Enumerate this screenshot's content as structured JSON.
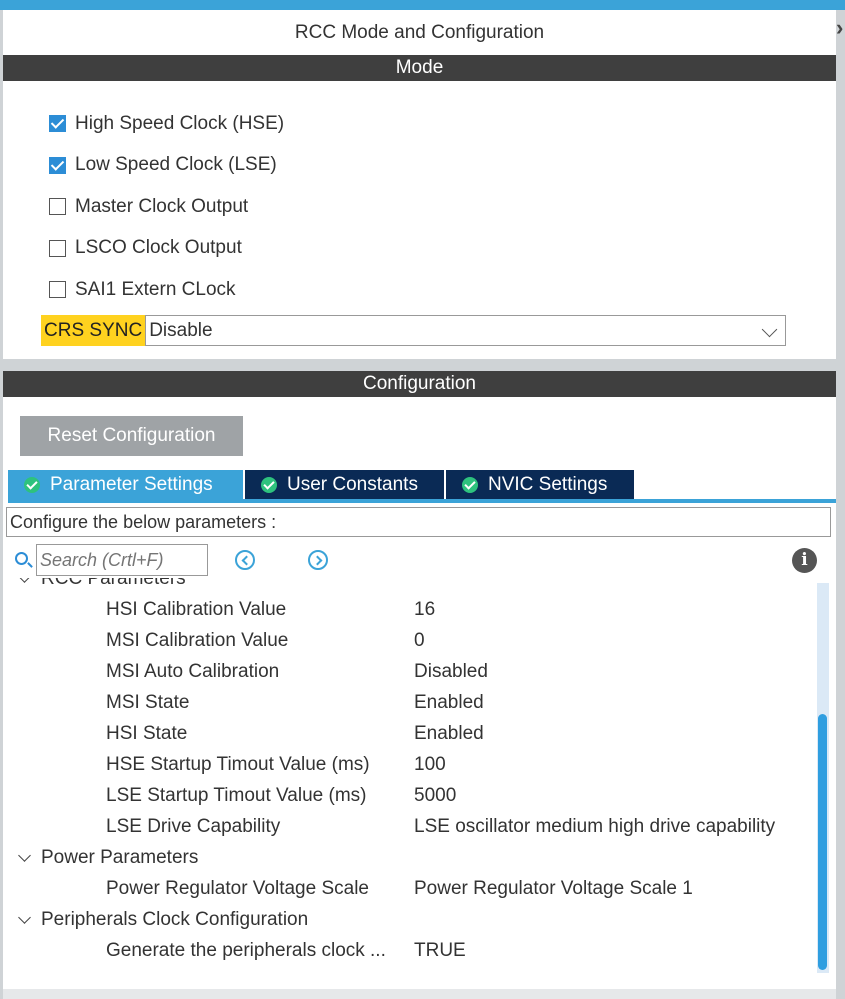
{
  "mode_panel": {
    "title": "RCC Mode and Configuration",
    "header": "Mode",
    "options": [
      {
        "label": "High Speed Clock (HSE)",
        "checked": true
      },
      {
        "label": "Low Speed Clock (LSE)",
        "checked": true
      },
      {
        "label": "Master Clock Output",
        "checked": false
      },
      {
        "label": "LSCO Clock Output",
        "checked": false
      },
      {
        "label": "SAI1 Extern CLock",
        "checked": false
      }
    ],
    "crs_sync": {
      "label": "CRS SYNC",
      "value": "Disable"
    }
  },
  "config_panel": {
    "header": "Configuration",
    "reset_button": "Reset Configuration",
    "tabs": [
      {
        "label": "Parameter Settings",
        "active": true
      },
      {
        "label": "User Constants",
        "active": false
      },
      {
        "label": "NVIC Settings",
        "active": false
      }
    ],
    "describe": "Configure the below parameters :",
    "search_placeholder": "Search (Crtl+F)",
    "groups": [
      {
        "label": "RCC Parameters",
        "params": [
          {
            "name": "HSI Calibration Value",
            "value": "16"
          },
          {
            "name": "MSI Calibration Value",
            "value": "0"
          },
          {
            "name": "MSI Auto Calibration",
            "value": "Disabled"
          },
          {
            "name": "MSI State",
            "value": "Enabled"
          },
          {
            "name": "HSI State",
            "value": "Enabled"
          },
          {
            "name": "HSE Startup Timout Value (ms)",
            "value": "100"
          },
          {
            "name": "LSE Startup Timout Value (ms)",
            "value": "5000"
          },
          {
            "name": "LSE Drive Capability",
            "value": "LSE oscillator medium high drive capability"
          }
        ]
      },
      {
        "label": "Power Parameters",
        "params": [
          {
            "name": "Power Regulator Voltage Scale",
            "value": "Power Regulator Voltage Scale 1"
          }
        ]
      },
      {
        "label": "Peripherals Clock Configuration",
        "params": [
          {
            "name": "Generate the peripherals clock ...",
            "value": "TRUE"
          }
        ]
      }
    ]
  },
  "colors": {
    "accent": "#3ba3d8",
    "tab_inactive": "#0a2a55",
    "header_bar": "#3f3f3f",
    "crs_highlight": "#ffd21f",
    "check_icon": "#2ec27e"
  }
}
